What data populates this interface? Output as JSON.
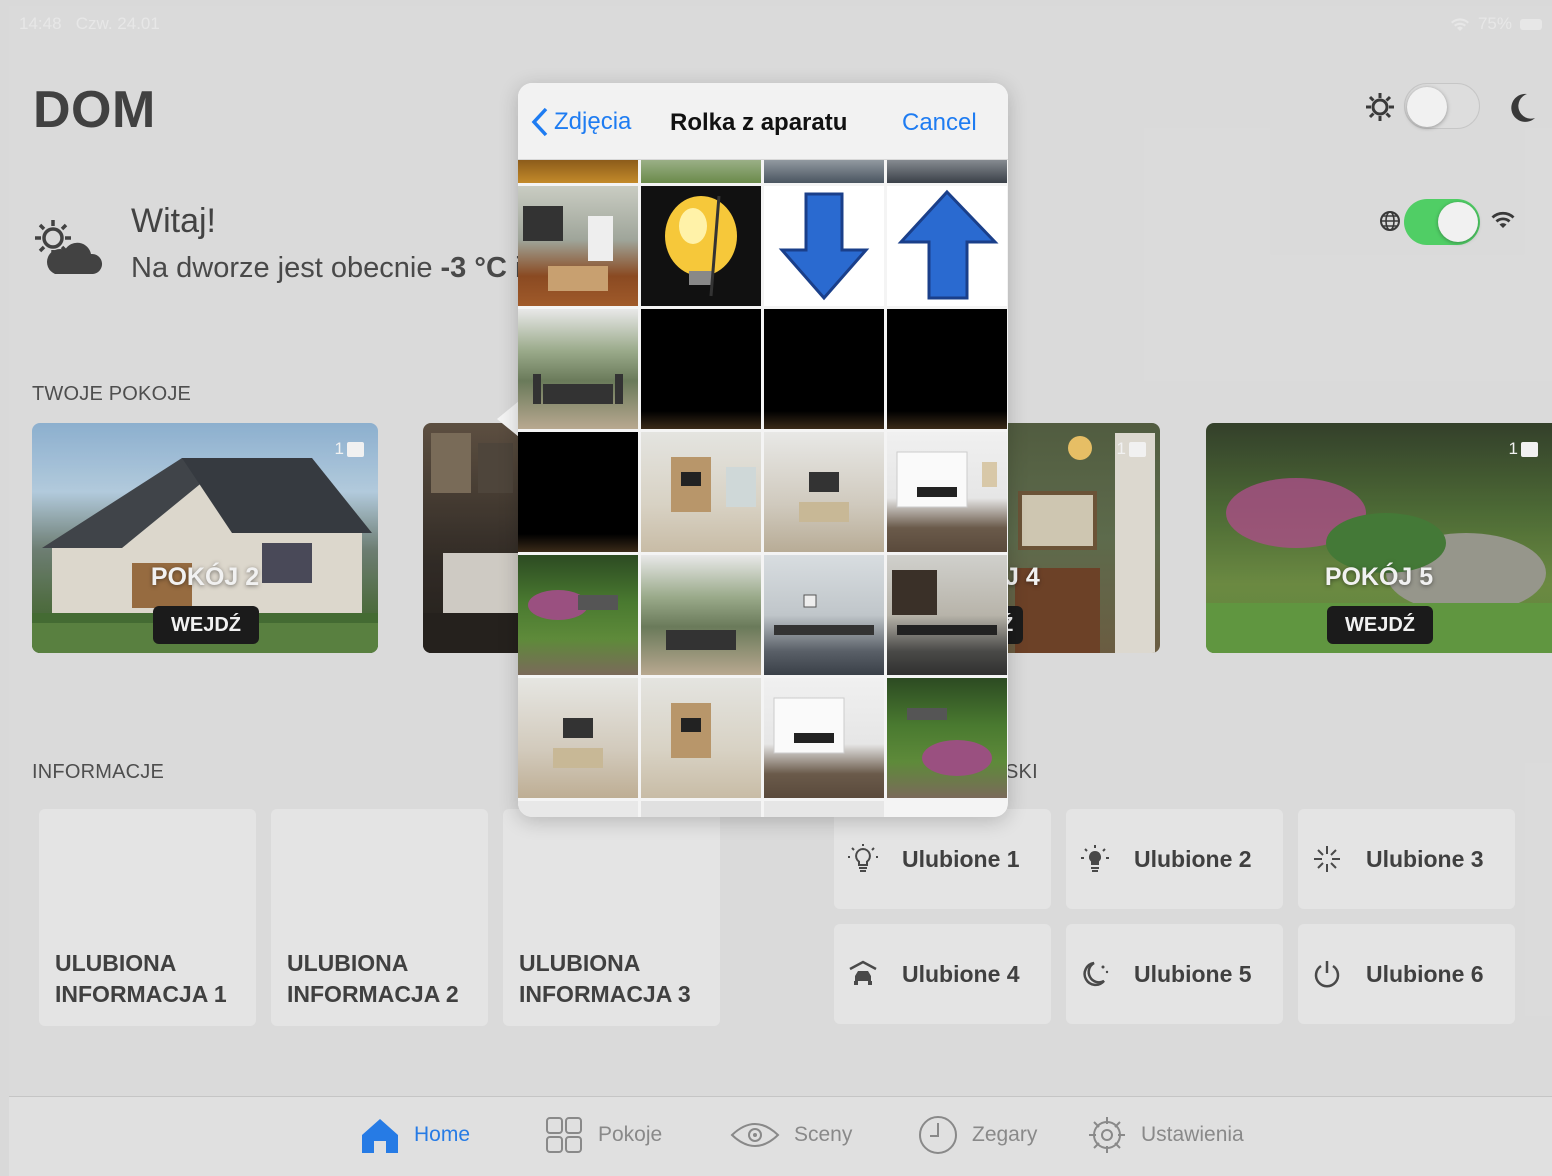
{
  "status": {
    "time": "14:48",
    "date": "Czw. 24.01",
    "battery": "75%"
  },
  "header": {
    "title": "DOM"
  },
  "weather": {
    "greeting": "Witaj!",
    "outside_prefix": "Na dworze jest obecnie",
    "temperature": "-3 °C",
    "outside_suffix": "i"
  },
  "sections": {
    "rooms": "TWOJE POKOJE",
    "info": "INFORMACJE",
    "favorites_partial": "SKI"
  },
  "rooms": [
    {
      "name": "POKÓJ 2",
      "enter": "WEJDŹ",
      "count": "1"
    },
    {
      "name": "J 4",
      "enter": "Ź",
      "count": "1"
    },
    {
      "name": "POKÓJ 5",
      "enter": "WEJDŹ",
      "count": "1"
    }
  ],
  "info_cards": [
    {
      "line1": "ULUBIONA",
      "line2": "INFORMACJA 1"
    },
    {
      "line1": "ULUBIONA",
      "line2": "INFORMACJA 2"
    },
    {
      "line1": "ULUBIONA",
      "line2": "INFORMACJA 3"
    }
  ],
  "favorites": [
    {
      "label": "Ulubione 1",
      "icon": "bulb-icon"
    },
    {
      "label": "Ulubione 2",
      "icon": "light-rays-icon"
    },
    {
      "label": "Ulubione 3",
      "icon": "sparkle-icon"
    },
    {
      "label": "Ulubione 4",
      "icon": "car-garage-icon"
    },
    {
      "label": "Ulubione 5",
      "icon": "moon-stars-icon"
    },
    {
      "label": "Ulubione 6",
      "icon": "power-icon"
    }
  ],
  "tabs": [
    {
      "label": "Home",
      "icon": "home-icon",
      "active": true
    },
    {
      "label": "Pokoje",
      "icon": "grid-icon",
      "active": false
    },
    {
      "label": "Sceny",
      "icon": "eye-icon",
      "active": false
    },
    {
      "label": "Zegary",
      "icon": "clock-icon",
      "active": false
    },
    {
      "label": "Ustawienia",
      "icon": "gear-icon",
      "active": false
    }
  ],
  "picker": {
    "back_label": "Zdjęcia",
    "title": "Rolka z aparatu",
    "cancel_label": "Cancel"
  },
  "toggles": {
    "dark_mode": false,
    "online": true
  },
  "colors": {
    "accent": "#1e7cf2",
    "toggle_on": "#4cd964"
  }
}
